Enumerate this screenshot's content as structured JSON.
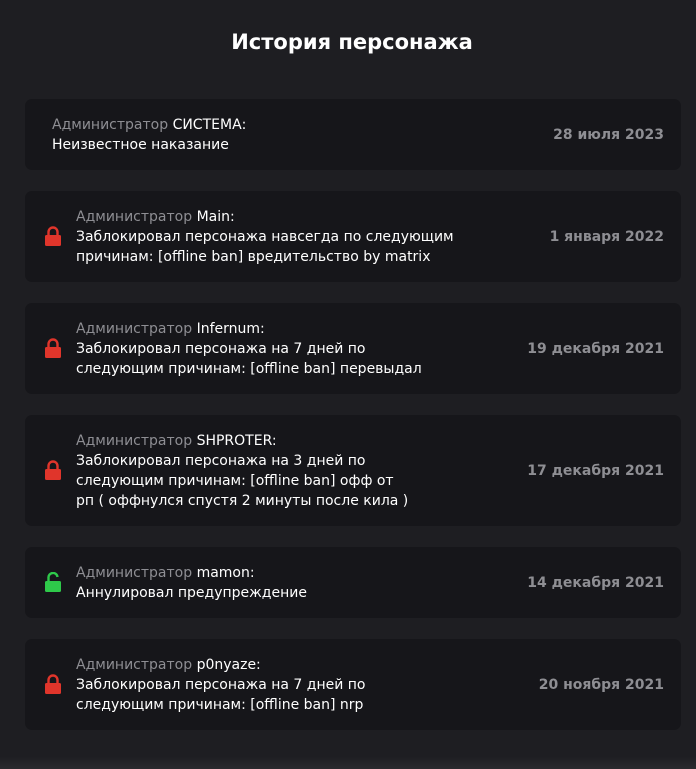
{
  "title": "История персонажа",
  "role_label": "Администратор",
  "colors": {
    "lock_red": "#e0352b",
    "lock_green": "#2ec94a"
  },
  "entries": [
    {
      "admin": "СИСТЕМА:",
      "text": "Неизвестное наказание",
      "date": "28 июля 2023",
      "icon": "none"
    },
    {
      "admin": "Main:",
      "text": "Заблокировал персонажа навсегда по следующим\nпричинам: [offline ban] вредительство by matrix",
      "date": "1 января 2022",
      "icon": "lock-closed-icon"
    },
    {
      "admin": "Infernum:",
      "text": "Заблокировал персонажа на 7 дней по\nследующим причинам: [offline ban] перевыдал",
      "date": "19 декабря 2021",
      "icon": "lock-closed-icon"
    },
    {
      "admin": "SHPROTER:",
      "text": "Заблокировал персонажа на 3 дней по\nследующим причинам: [offline ban] офф от\nрп ( оффнулся спустя 2 минуты после кила )",
      "date": "17 декабря 2021",
      "icon": "lock-closed-icon"
    },
    {
      "admin": "mamon:",
      "text": "Аннулировал предупреждение",
      "date": "14 декабря 2021",
      "icon": "lock-open-icon"
    },
    {
      "admin": "p0nyaze:",
      "text": "Заблокировал персонажа на 7 дней по\nследующим причинам: [offline ban] nrp",
      "date": "20 ноября 2021",
      "icon": "lock-closed-icon"
    }
  ]
}
